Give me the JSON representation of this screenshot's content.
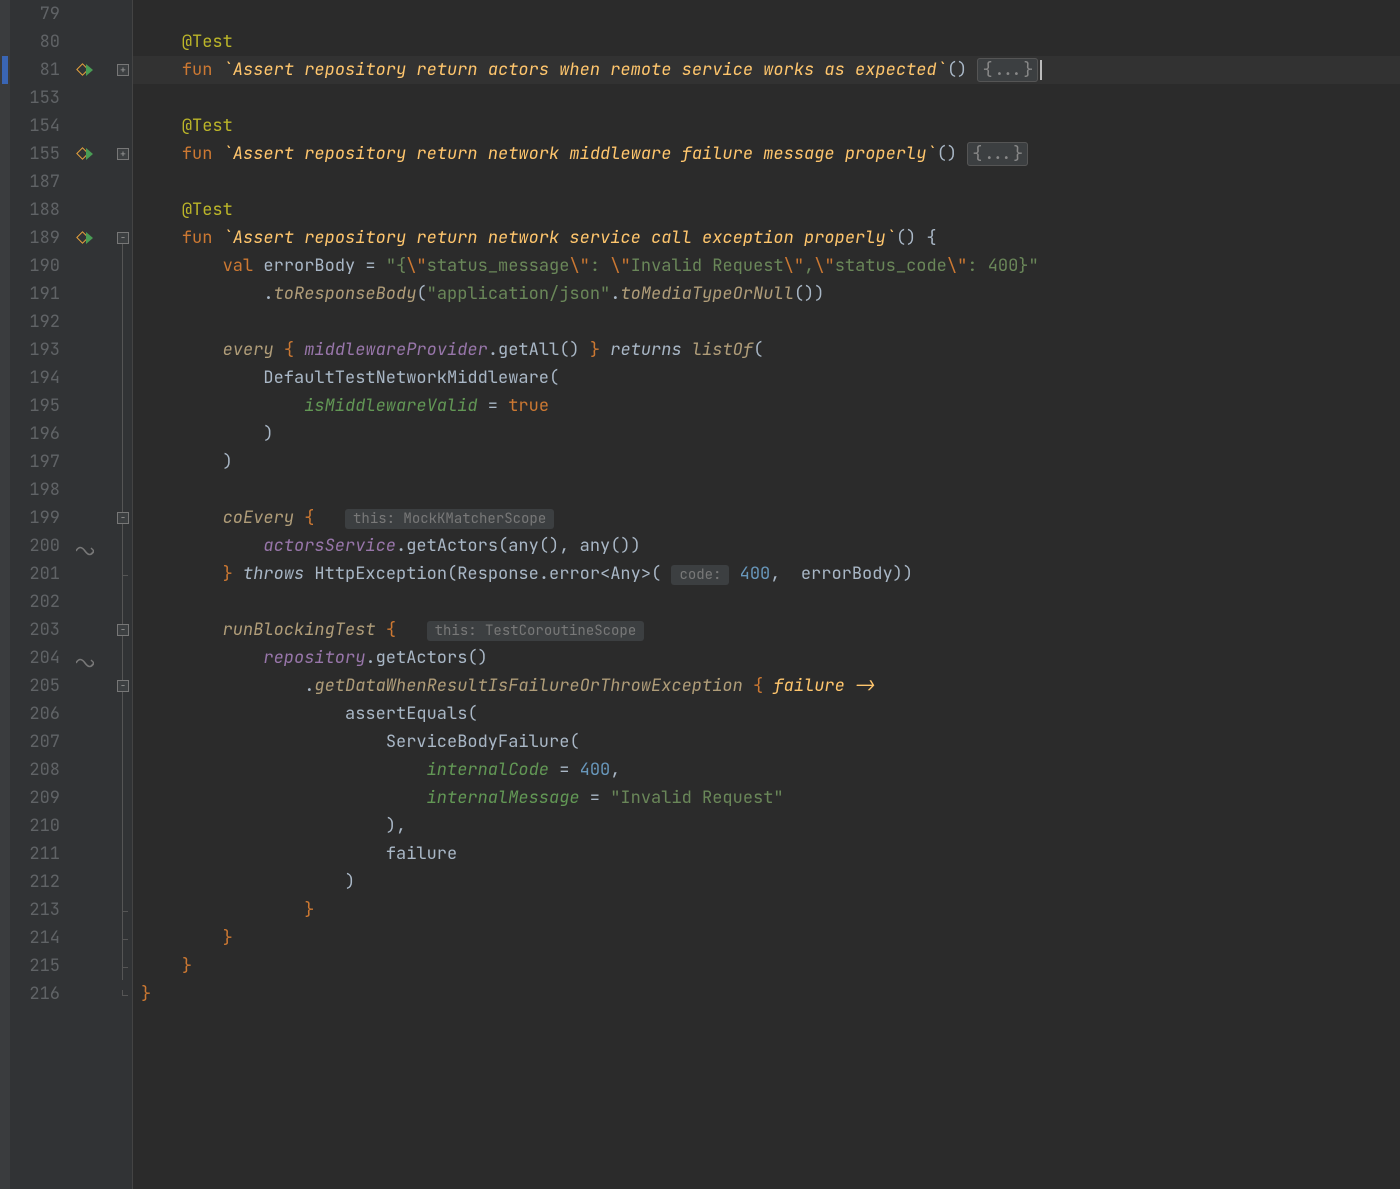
{
  "lineNumbers": [
    "79",
    "80",
    "81",
    "153",
    "154",
    "155",
    "187",
    "188",
    "189",
    "190",
    "191",
    "192",
    "193",
    "194",
    "195",
    "196",
    "197",
    "198",
    "199",
    "200",
    "201",
    "202",
    "203",
    "204",
    "205",
    "206",
    "207",
    "208",
    "209",
    "210",
    "211",
    "212",
    "213",
    "214",
    "215",
    "216"
  ],
  "folded": "{...}",
  "hints": {
    "mockk": "this: MockKMatcherScope",
    "testScope": "this: TestCoroutineScope",
    "code": "code:"
  },
  "l": {
    "atTest": "@Test",
    "fun": "fun",
    "val": "val",
    "returns": "returns",
    "throws": "throws",
    "true": "true",
    "name1": "`Assert repository return actors when remote service works as expected`",
    "name2": "`Assert repository return network middleware failure message properly`",
    "name3": "`Assert repository return network service call exception properly`",
    "errorBodyDecl": "errorBody = ",
    "str_open": "\"",
    "str_a": "{",
    "esc": "\\\"",
    "str_b": "status_message",
    "str_c": ": ",
    "str_d": "Invalid Request",
    "str_e": ",",
    "str_f": "status_code",
    "str_g": ": 400}",
    "toResponseBody": "toResponseBody",
    "appjson": "\"application/json\"",
    "toMediaTypeOrNull": "toMediaTypeOrNull",
    "every": "every",
    "middlewareProvider": "middlewareProvider",
    "getAll": ".getAll()",
    "listOf": "listOf",
    "defaultMw": "DefaultTestNetworkMiddleware(",
    "isMiddlewareValid": "isMiddlewareValid",
    "eq": " = ",
    "coEvery": "coEvery",
    "actorsService": "actorsService",
    "getActors": ".getActors(any(), any())",
    "httpEx": "HttpException(Response.error<Any>(",
    "fourHundred": "400",
    "comma": ", ",
    "errorBody": " errorBody))",
    "runBlockingTest": "runBlockingTest",
    "repository": "repository",
    "getActorsCall": ".getActors()",
    "getDataWhen": "getDataWhenResultIsFailureOrThrowException",
    "failureArrow": " failure ->",
    "assertEquals": "assertEquals(",
    "serviceBodyFailure": "ServiceBodyFailure(",
    "internalCode": "internalCode",
    "internalMessage": "internalMessage",
    "invalidRequest": "\"Invalid Request\"",
    "failure": "failure",
    "paren_close": ")",
    "paren_close_comma": "),",
    "brace_close": "}",
    "brace_open": " {",
    "parens": "()"
  }
}
